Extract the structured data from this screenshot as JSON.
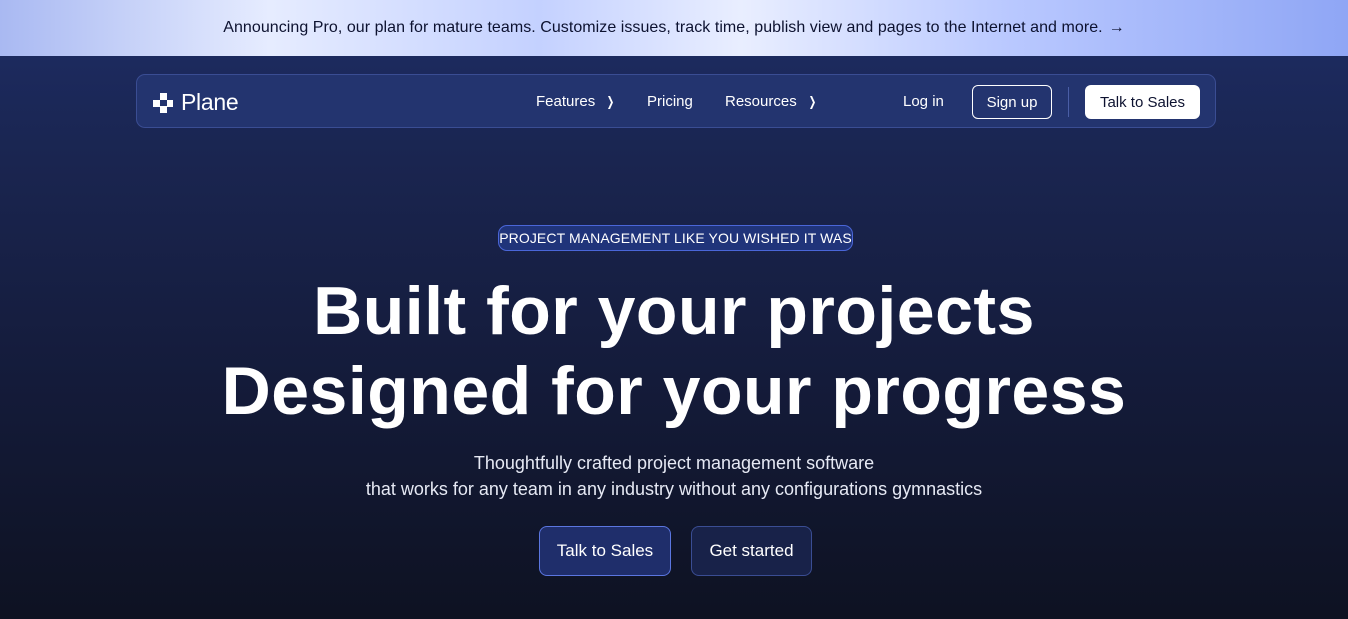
{
  "announcement": {
    "text": "Announcing Pro, our plan for mature teams. Customize issues, track time, publish view and pages to the Internet and more.",
    "arrow": "→"
  },
  "nav": {
    "logo_text": "Plane",
    "links": [
      {
        "label": "Features",
        "has_chevron": true
      },
      {
        "label": "Pricing",
        "has_chevron": false
      },
      {
        "label": "Resources",
        "has_chevron": true
      }
    ],
    "chevron": "❯",
    "login": "Log in",
    "signup": "Sign up",
    "talk_to_sales": "Talk to Sales"
  },
  "hero": {
    "badge": "PROJECT MANAGEMENT LIKE YOU WISHED IT WAS",
    "title_line1": "Built for your projects",
    "title_line2": "Designed for your progress",
    "subtitle_line1": "Thoughtfully crafted project management software",
    "subtitle_line2": "that works for any team in any industry without any configurations gymnastics",
    "cta_primary": "Talk to Sales",
    "cta_secondary": "Get started"
  },
  "colors": {
    "accent_border": "#5b76e0",
    "nav_bg": "#23346f"
  }
}
